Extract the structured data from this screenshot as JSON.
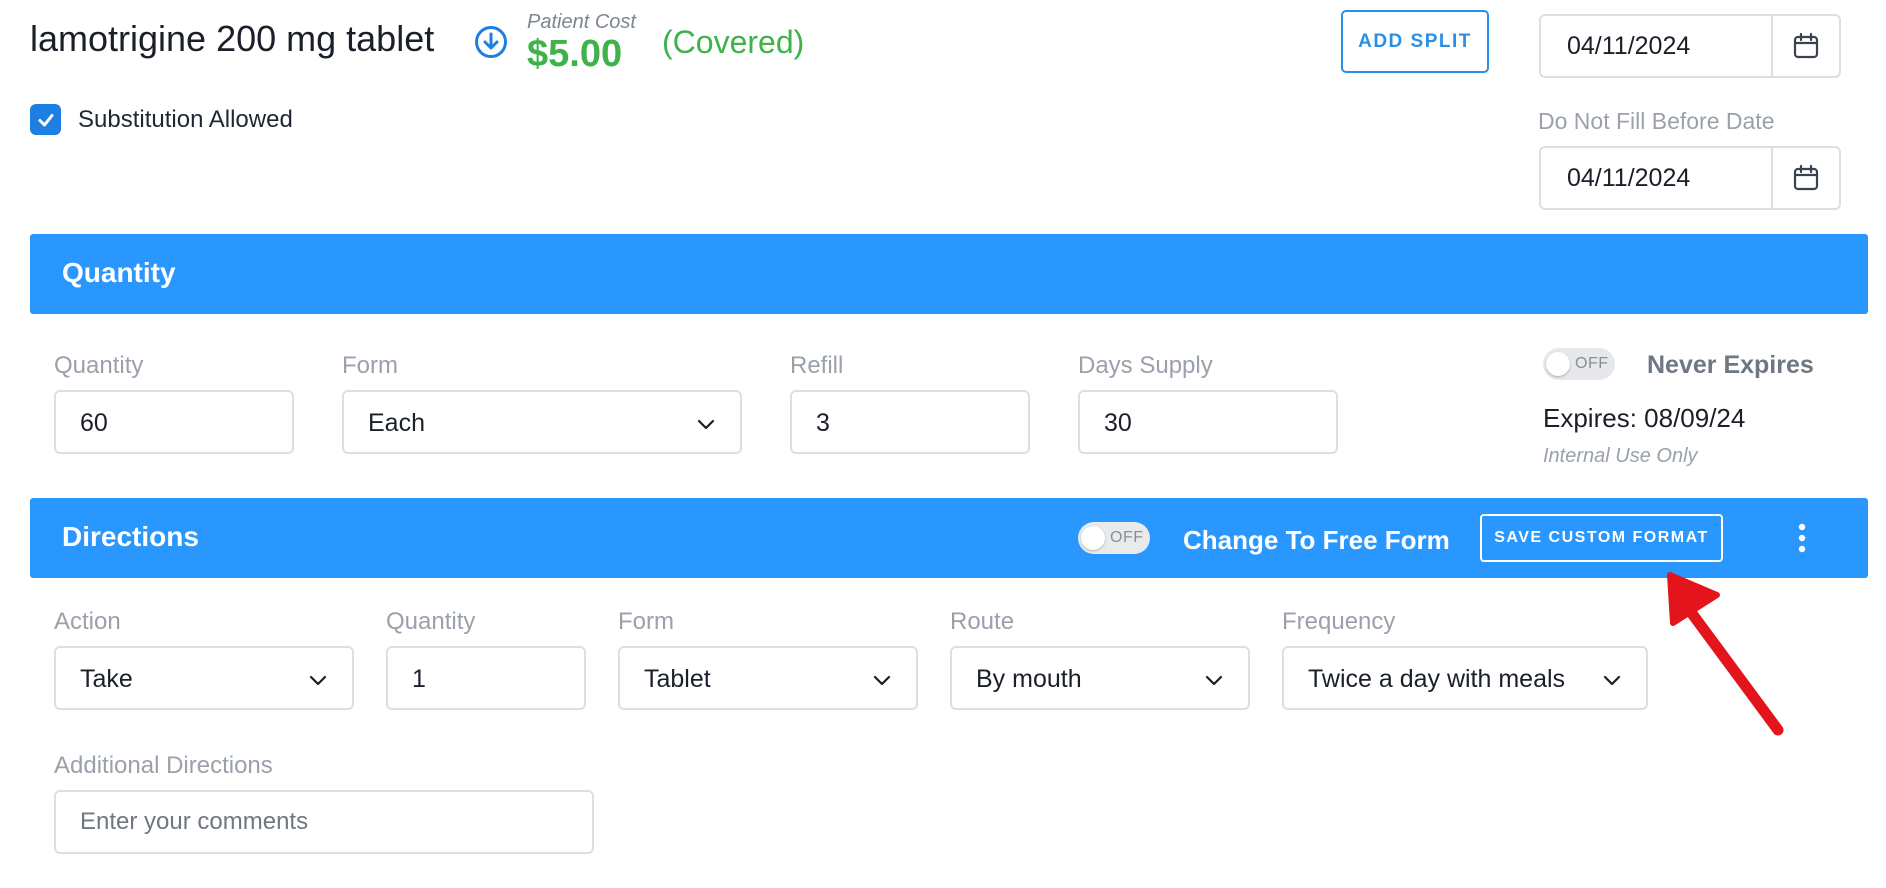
{
  "header": {
    "drug_name": "lamotrigine 200 mg tablet",
    "patient_cost_label": "Patient Cost",
    "patient_cost_value": "$5.00",
    "coverage_status": "(Covered)",
    "add_split_label": "ADD SPLIT",
    "date_value": "04/11/2024",
    "substitution_label": "Substitution Allowed",
    "substitution_checked": true,
    "do_not_fill_label": "Do Not Fill Before Date",
    "do_not_fill_value": "04/11/2024"
  },
  "quantity_section": {
    "title": "Quantity",
    "quantity_label": "Quantity",
    "quantity_value": "60",
    "form_label": "Form",
    "form_value": "Each",
    "refill_label": "Refill",
    "refill_value": "3",
    "days_supply_label": "Days Supply",
    "days_supply_value": "30",
    "never_expires_toggle": "OFF",
    "never_expires_label": "Never Expires",
    "expires_text": "Expires: 08/09/24",
    "internal_use_text": "Internal Use Only"
  },
  "directions_section": {
    "title": "Directions",
    "free_form_toggle": "OFF",
    "free_form_label": "Change To Free Form",
    "save_custom_label": "SAVE CUSTOM FORMAT",
    "action_label": "Action",
    "action_value": "Take",
    "quantity_label": "Quantity",
    "quantity_value": "1",
    "form_label": "Form",
    "form_value": "Tablet",
    "route_label": "Route",
    "route_value": "By mouth",
    "frequency_label": "Frequency",
    "frequency_value": "Twice a day with meals",
    "additional_label": "Additional Directions",
    "additional_placeholder": "Enter your comments"
  },
  "colors": {
    "accent_blue": "#2a97ff",
    "covered_green": "#3fb24a",
    "annotation_red": "#e3141b"
  },
  "icons": [
    "download-circle-icon",
    "calendar-icon",
    "checkmark-icon",
    "chevron-down-icon",
    "kebab-menu-icon",
    "annotation-arrow-icon"
  ]
}
